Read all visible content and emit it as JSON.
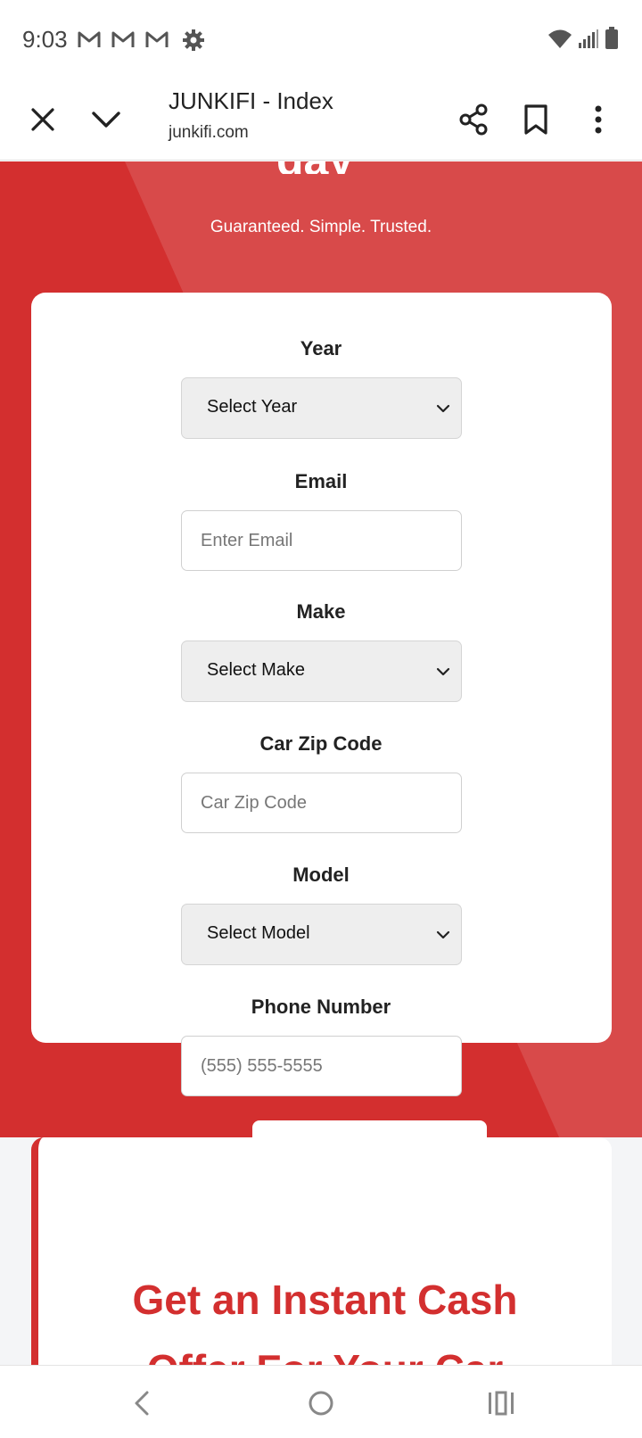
{
  "status_bar": {
    "time": "9:03",
    "left_icons": [
      "gmail-icon",
      "gmail-icon",
      "gmail-icon",
      "settings-icon"
    ],
    "right_icons": [
      "wifi-icon",
      "signal-icon",
      "battery-icon"
    ]
  },
  "browser": {
    "title": "JUNKIFI - Index",
    "url": "junkifi.com",
    "icons": [
      "close-icon",
      "chevron-down-icon",
      "share-icon",
      "bookmark-icon",
      "more-vert-icon"
    ]
  },
  "hero": {
    "heading_fragment": "day",
    "tagline": "Guaranteed. Simple. Trusted.",
    "colors": {
      "primary": "#d32f2f",
      "stripe": "#d84a4a"
    }
  },
  "form": {
    "year": {
      "label": "Year",
      "value": "Select Year"
    },
    "email": {
      "label": "Email",
      "placeholder": "Enter Email"
    },
    "make": {
      "label": "Make",
      "value": "Select Make"
    },
    "zip": {
      "label": "Car Zip Code",
      "placeholder": "Car Zip Code"
    },
    "model": {
      "label": "Model",
      "value": "Select Model"
    },
    "phone": {
      "label": "Phone Number",
      "placeholder": "(555) 555-5555"
    }
  },
  "offer": {
    "heading_line1": "Get an Instant Cash",
    "heading_line2": "Offer For Your Car"
  },
  "nav": {
    "icons": [
      "back-icon",
      "home-icon",
      "recents-icon"
    ]
  }
}
